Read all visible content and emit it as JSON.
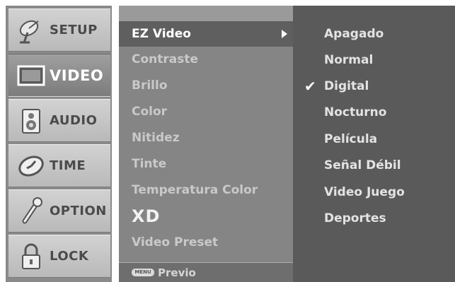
{
  "tabs": [
    {
      "label": "SETUP",
      "icon": "satellite-dish-icon",
      "active": false
    },
    {
      "label": "VIDEO",
      "icon": "monitor-icon",
      "active": true
    },
    {
      "label": "AUDIO",
      "icon": "speaker-icon",
      "active": false
    },
    {
      "label": "TIME",
      "icon": "clock-icon",
      "active": false
    },
    {
      "label": "OPTION",
      "icon": "wrench-icon",
      "active": false
    },
    {
      "label": "LOCK",
      "icon": "padlock-icon",
      "active": false
    }
  ],
  "menu": {
    "items": [
      {
        "label": "EZ Video",
        "selected": true
      },
      {
        "label": "Contraste"
      },
      {
        "label": "Brillo"
      },
      {
        "label": "Color"
      },
      {
        "label": "Nitidez"
      },
      {
        "label": "Tinte"
      },
      {
        "label": "Temperatura Color"
      },
      {
        "label": "XD"
      },
      {
        "label": "Video Preset"
      }
    ],
    "footer_key": "MENU",
    "footer_label": "Previo"
  },
  "submenu": {
    "items": [
      {
        "label": "Apagado"
      },
      {
        "label": "Normal"
      },
      {
        "label": "Digital",
        "checked": true
      },
      {
        "label": "Nocturno"
      },
      {
        "label": "Película"
      },
      {
        "label": "Señal Débil"
      },
      {
        "label": "Video Juego"
      },
      {
        "label": "Deportes"
      }
    ],
    "check_glyph": "✔"
  },
  "colors": {
    "tab_active": "#8a8a8a",
    "menu_bg": "#858585",
    "submenu_bg": "#5a5a5a"
  }
}
